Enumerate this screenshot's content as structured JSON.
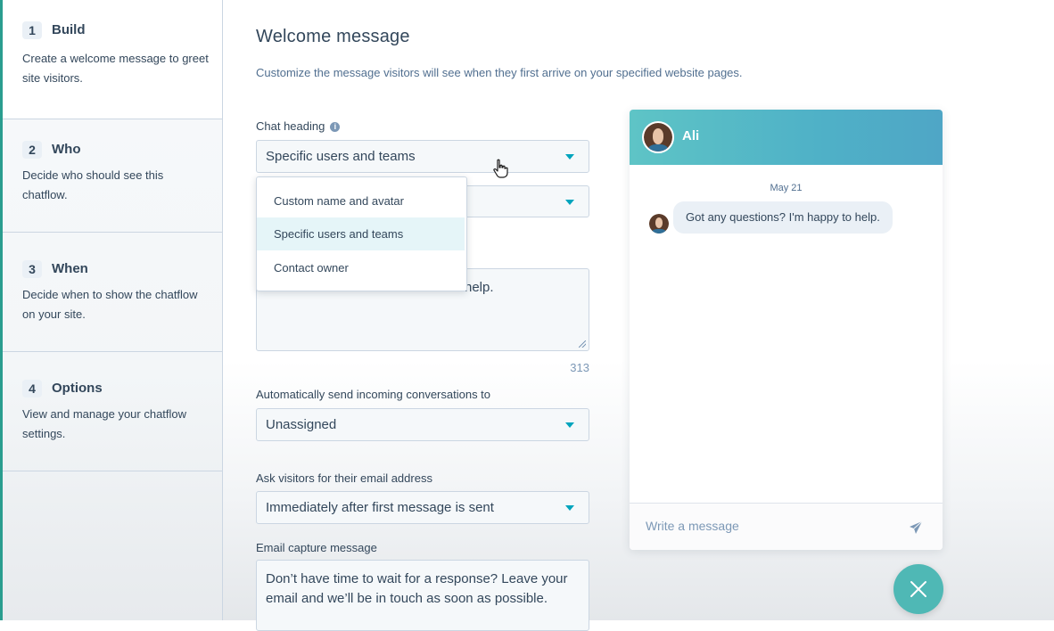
{
  "steps": [
    {
      "number": "1",
      "name": "Build",
      "description": "Create a welcome message to greet site visitors."
    },
    {
      "number": "2",
      "name": "Who",
      "description": "Decide who should see this chatflow."
    },
    {
      "number": "3",
      "name": "When",
      "description": "Decide when to show the chatflow on your site."
    },
    {
      "number": "4",
      "name": "Options",
      "description": "View and manage your chatflow settings."
    }
  ],
  "main": {
    "title": "Welcome message",
    "subtitle": "Customize the message visitors will see when they first arrive on your specified website pages.",
    "chat_heading": {
      "label": "Chat heading",
      "selected": "Specific users and teams",
      "options": [
        "Custom name and avatar",
        "Specific users and teams",
        "Contact owner"
      ],
      "hovered_option": "Specific users and teams"
    },
    "welcome_message": {
      "value_visible": "help.",
      "char_count": "313"
    },
    "routing": {
      "label": "Automatically send incoming conversations to",
      "selected": "Unassigned"
    },
    "email_ask": {
      "label": "Ask visitors for their email address",
      "selected": "Immediately after first message is sent"
    },
    "email_capture": {
      "label": "Email capture message",
      "value": "Don’t have time to wait for a response? Leave your email and we’ll be in touch as soon as possible."
    }
  },
  "chat_preview": {
    "agent_name": "Ali",
    "date": "May 21",
    "message": "Got any questions? I'm happy to help.",
    "input_placeholder": "Write a message"
  },
  "colors": {
    "accent": "#00a4bd",
    "header_teal": "#5ec4c6",
    "text": "#33475b",
    "fab": "#4fb8b5"
  },
  "icons": {
    "info": "info-icon",
    "caret": "chevron-down-icon",
    "send": "paper-plane-icon",
    "close": "close-icon",
    "cursor": "hand-pointer-icon"
  }
}
